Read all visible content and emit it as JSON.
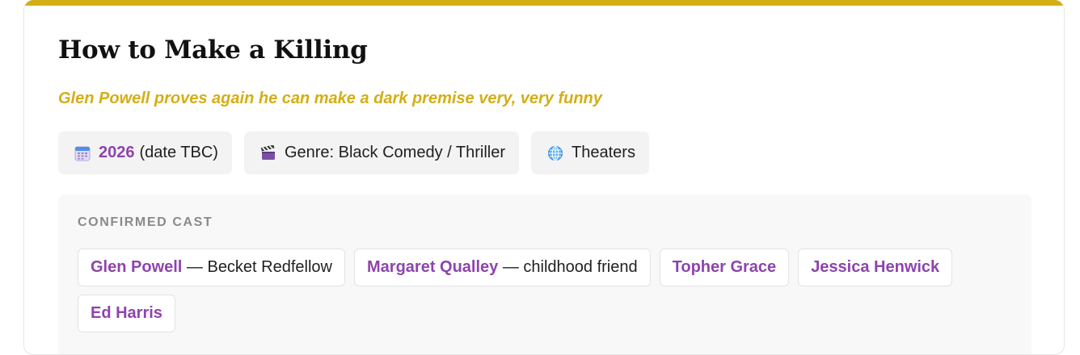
{
  "movie": {
    "title": "How to Make a Killing",
    "tagline": "Glen Powell proves again he can make a dark premise very, very funny"
  },
  "info_chips": {
    "release": {
      "icon": "calendar-icon",
      "year": "2026",
      "note": "(date TBC)"
    },
    "genre": {
      "icon": "clapperboard-icon",
      "text": "Genre: Black Comedy / Thriller"
    },
    "distribution": {
      "icon": "globe-icon",
      "text": "Theaters"
    }
  },
  "cast": {
    "heading": "CONFIRMED CAST",
    "members": [
      {
        "name": "Glen Powell",
        "role": "— Becket Redfellow"
      },
      {
        "name": "Margaret Qualley",
        "role": "— childhood friend"
      },
      {
        "name": "Topher Grace",
        "role": ""
      },
      {
        "name": "Jessica Henwick",
        "role": ""
      },
      {
        "name": "Ed Harris",
        "role": ""
      }
    ]
  },
  "colors": {
    "accent": "#d4ae16",
    "name_purple": "#8e44ad"
  }
}
